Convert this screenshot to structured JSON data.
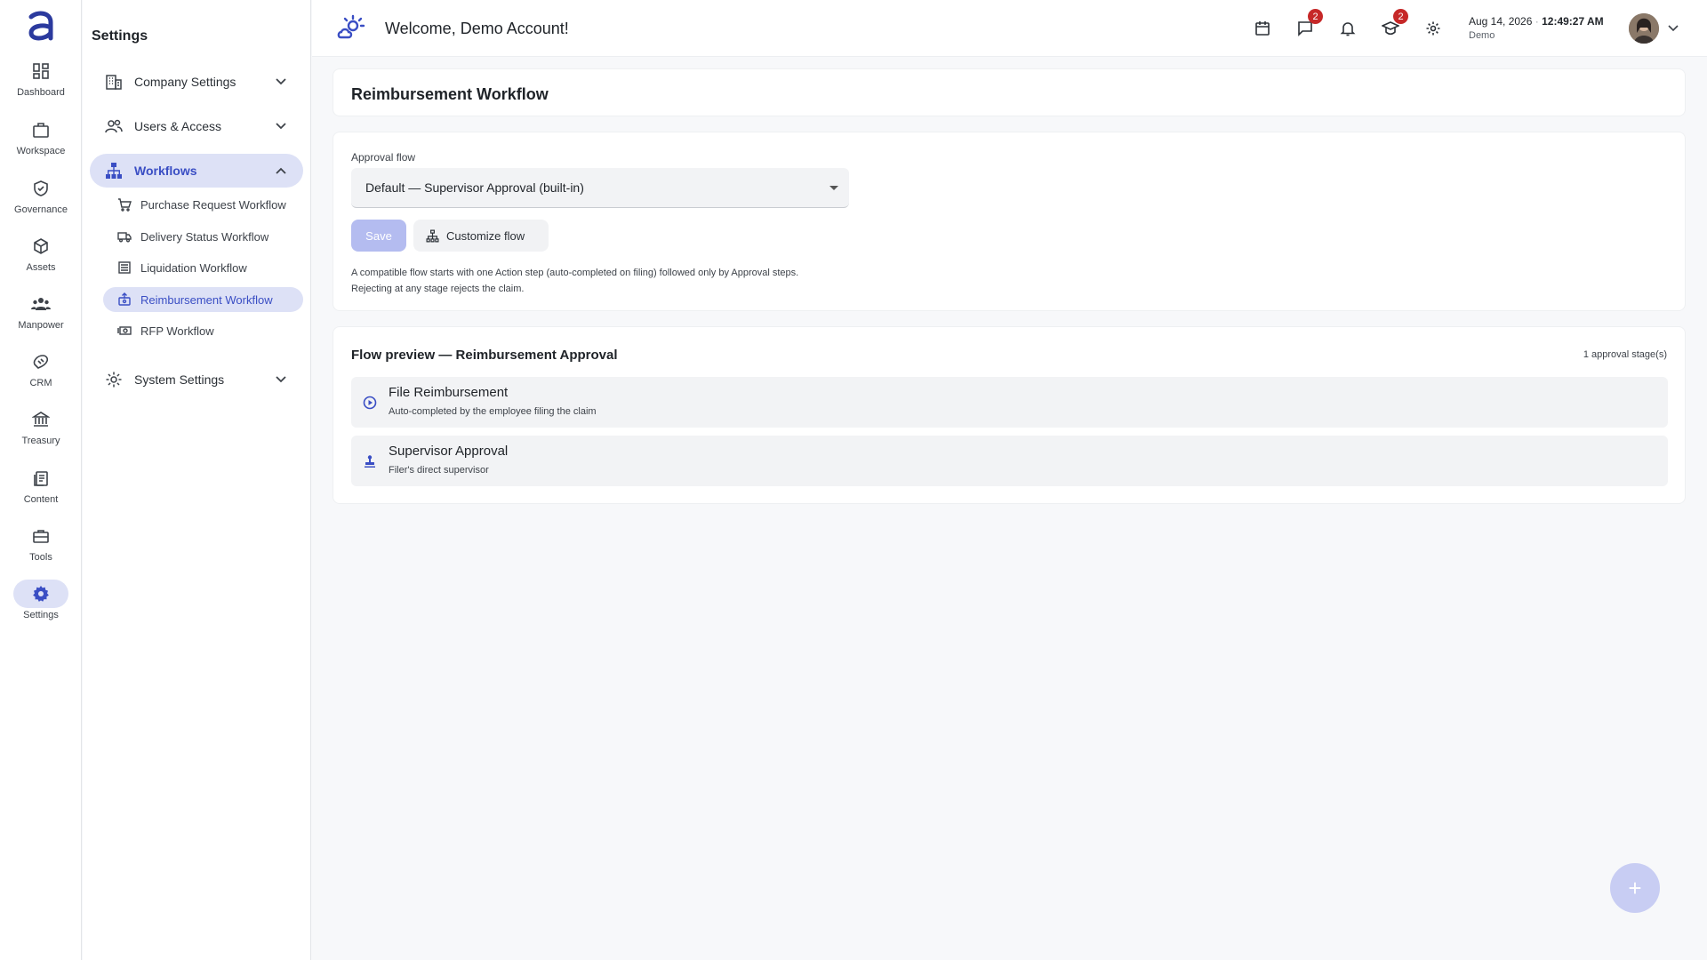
{
  "rail": {
    "items": [
      {
        "label": "Dashboard",
        "icon": "dashboard-icon"
      },
      {
        "label": "Workspace",
        "icon": "briefcase-icon"
      },
      {
        "label": "Governance",
        "icon": "shield-check-icon"
      },
      {
        "label": "Assets",
        "icon": "cube-icon"
      },
      {
        "label": "Manpower",
        "icon": "people-icon"
      },
      {
        "label": "CRM",
        "icon": "handshake-icon"
      },
      {
        "label": "Treasury",
        "icon": "bank-icon"
      },
      {
        "label": "Content",
        "icon": "documents-icon"
      },
      {
        "label": "Tools",
        "icon": "toolbox-icon"
      },
      {
        "label": "Settings",
        "icon": "gear-icon",
        "active": true
      }
    ]
  },
  "sidebar": {
    "title": "Settings",
    "groups": [
      {
        "label": "Company Settings",
        "icon": "building-icon",
        "expanded": false
      },
      {
        "label": "Users & Access",
        "icon": "users-icon",
        "expanded": false
      },
      {
        "label": "Workflows",
        "icon": "sitemap-icon",
        "expanded": true
      },
      {
        "label": "System Settings",
        "icon": "gear-icon",
        "expanded": false
      }
    ],
    "workflow_items": [
      {
        "label": "Purchase Request Workflow",
        "icon": "cart-icon"
      },
      {
        "label": "Delivery Status Workflow",
        "icon": "truck-icon"
      },
      {
        "label": "Liquidation Workflow",
        "icon": "list-icon"
      },
      {
        "label": "Reimbursement Workflow",
        "icon": "reimburse-icon",
        "active": true
      },
      {
        "label": "RFP Workflow",
        "icon": "cash-icon"
      }
    ]
  },
  "topbar": {
    "welcome": "Welcome, Demo Account!",
    "messages_badge": "2",
    "learning_badge": "2",
    "date": "Aug 14, 2026",
    "date_separator": "·",
    "time": "12:49:27 AM",
    "user": "Demo"
  },
  "main": {
    "page_title": "Reimbursement Workflow",
    "approval_flow_label": "Approval flow",
    "approval_flow_value": "Default — Supervisor Approval (built-in)",
    "save_label": "Save",
    "customize_label": "Customize flow",
    "help_line1": "A compatible flow starts with one Action step (auto-completed on filing) followed only by Approval steps.",
    "help_line2": "Rejecting at any stage rejects the claim.",
    "preview_title": "Flow preview — Reimbursement Approval",
    "preview_count": "1 approval stage(s)",
    "steps": [
      {
        "title": "File Reimbursement",
        "subtitle": "Auto-completed by the employee filing the claim",
        "icon": "play-circle-icon"
      },
      {
        "title": "Supervisor Approval",
        "subtitle": "Filer's direct supervisor",
        "icon": "stamp-icon"
      }
    ]
  },
  "fab": {
    "label": "+"
  },
  "colors": {
    "accent": "#3a4ec4",
    "active_bg": "#dde1f6",
    "badge": "#c62828",
    "save_disabled": "#b4bcf0"
  }
}
